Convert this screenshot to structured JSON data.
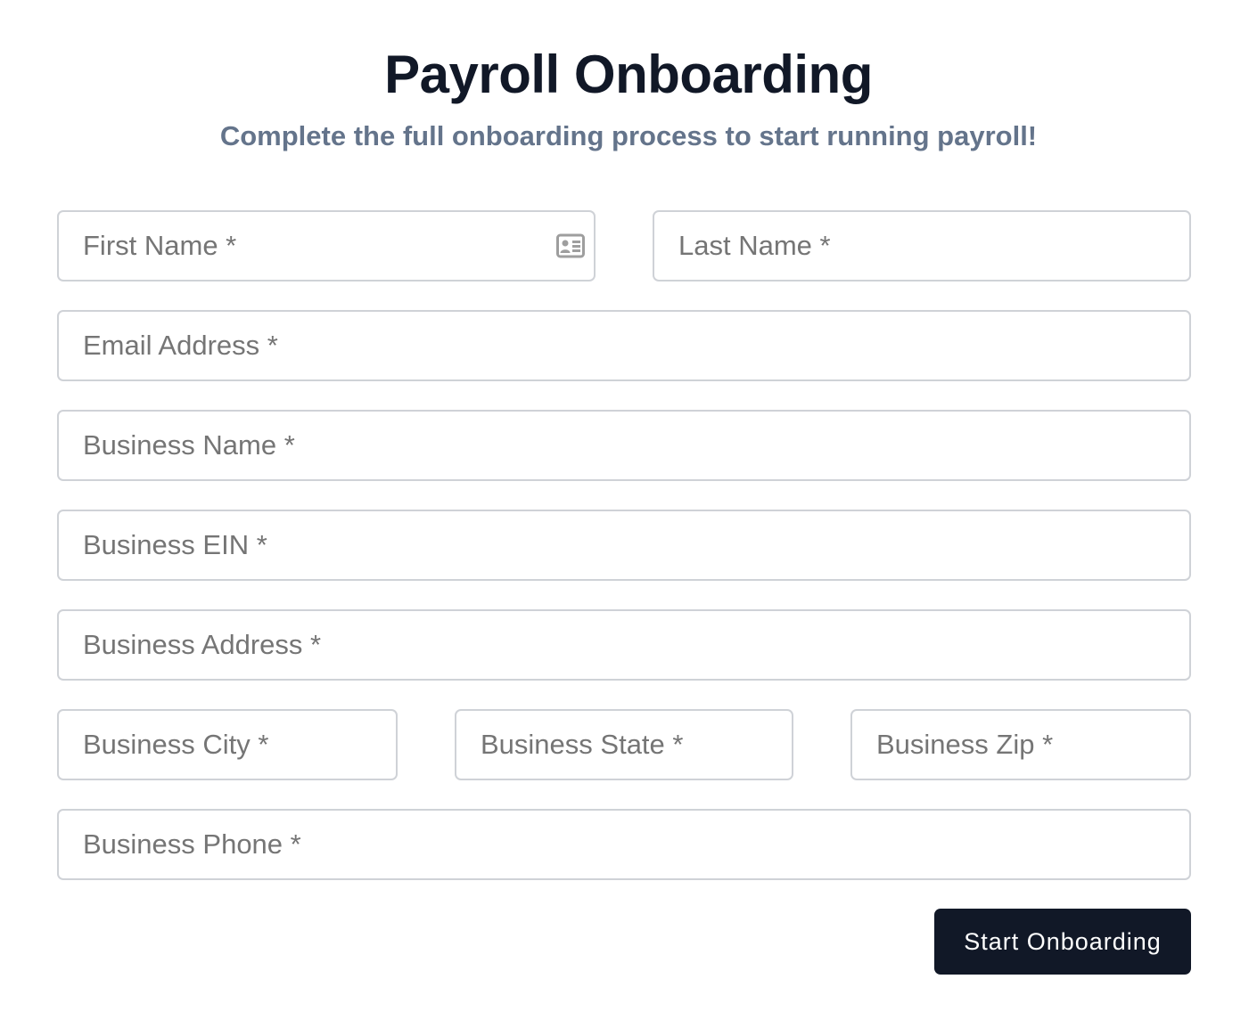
{
  "page": {
    "title": "Payroll Onboarding",
    "subtitle": "Complete the full onboarding process to start running payroll!"
  },
  "form": {
    "fields": {
      "first_name": {
        "placeholder": "First Name *",
        "value": ""
      },
      "last_name": {
        "placeholder": "Last Name *",
        "value": ""
      },
      "email": {
        "placeholder": "Email Address *",
        "value": ""
      },
      "business_name": {
        "placeholder": "Business Name *",
        "value": ""
      },
      "business_ein": {
        "placeholder": "Business EIN *",
        "value": ""
      },
      "business_address": {
        "placeholder": "Business Address *",
        "value": ""
      },
      "business_city": {
        "placeholder": "Business City *",
        "value": ""
      },
      "business_state": {
        "placeholder": "Business State *",
        "value": ""
      },
      "business_zip": {
        "placeholder": "Business Zip *",
        "value": ""
      },
      "business_phone": {
        "placeholder": "Business Phone *",
        "value": ""
      }
    },
    "autofill_icon": "contact-card-icon",
    "submit_label": "Start Onboarding"
  },
  "colors": {
    "title": "#111827",
    "subtitle": "#64748b",
    "field_border": "#cfd2d7",
    "placeholder": "#757575",
    "button_bg": "#111827",
    "button_text": "#ffffff",
    "icon": "#9e9e9e"
  }
}
